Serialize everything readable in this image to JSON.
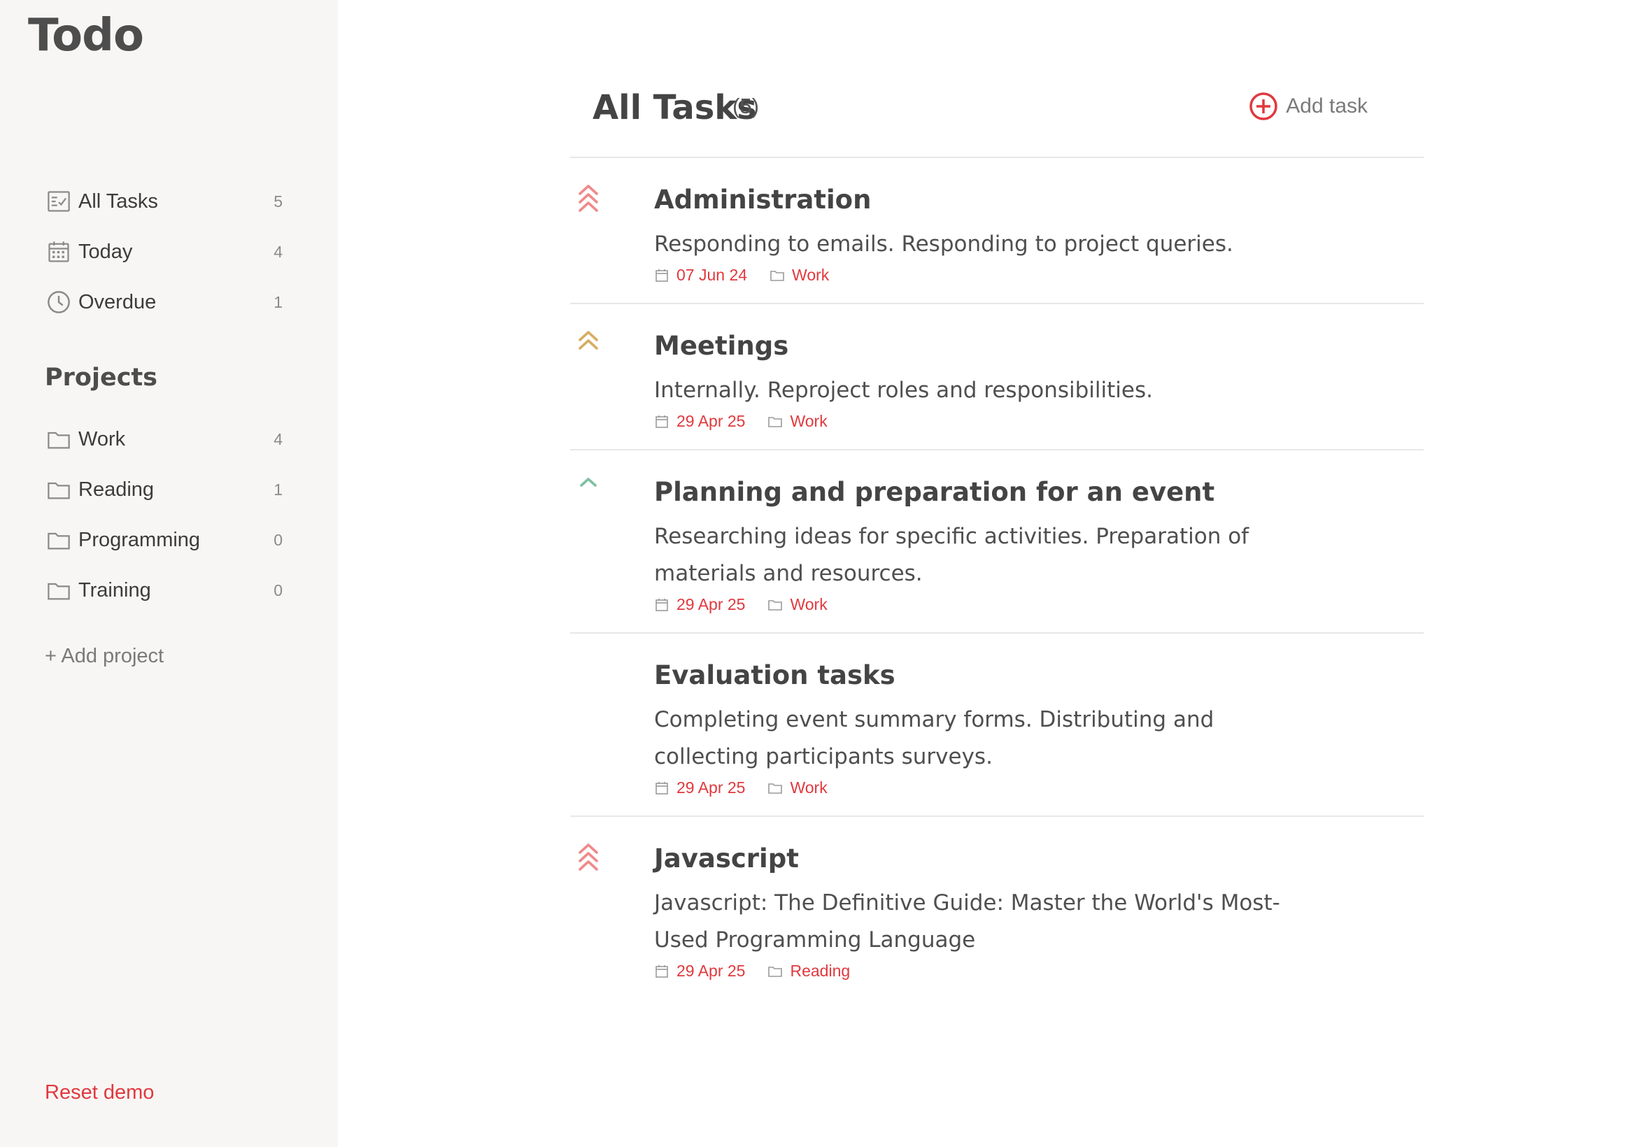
{
  "app": {
    "title": "Todo"
  },
  "sidebar": {
    "nav": [
      {
        "label": "All Tasks",
        "count": "5",
        "icon": "task-list-icon"
      },
      {
        "label": "Today",
        "count": "4",
        "icon": "calendar-icon"
      },
      {
        "label": "Overdue",
        "count": "1",
        "icon": "clock-icon"
      }
    ],
    "projects_heading": "Projects",
    "projects": [
      {
        "label": "Work",
        "count": "4",
        "icon": "folder-icon"
      },
      {
        "label": "Reading",
        "count": "1",
        "icon": "folder-icon"
      },
      {
        "label": "Programming",
        "count": "0",
        "icon": "folder-icon"
      },
      {
        "label": "Training",
        "count": "0",
        "icon": "folder-icon"
      }
    ],
    "add_project": "+ Add project",
    "reset_demo": "Reset demo"
  },
  "main": {
    "title": "All Tasks",
    "count": "(5)",
    "add_task": "Add task"
  },
  "colors": {
    "accent": "#e0393e",
    "priority_high": "#ef8a8a",
    "priority_medium": "#d6ae62",
    "priority_low": "#7fbfa3",
    "sidebar_bg": "#f8f6f4"
  },
  "tasks": [
    {
      "title": "Administration",
      "description": "Responding to emails. Responding to project queries.",
      "date": "07 Jun 24",
      "project": "Work",
      "priority": "high"
    },
    {
      "title": "Meetings",
      "description": "Internally. Reproject roles and responsibilities.",
      "date": "29 Apr 25",
      "project": "Work",
      "priority": "medium"
    },
    {
      "title": "Planning and preparation for an event",
      "description": "Researching ideas for specific activities. Preparation of materials and resources.",
      "date": "29 Apr 25",
      "project": "Work",
      "priority": "low"
    },
    {
      "title": "Evaluation tasks",
      "description": "Completing event summary forms. Distributing and collecting participants surveys.",
      "date": "29 Apr 25",
      "project": "Work",
      "priority": "none"
    },
    {
      "title": "Javascript",
      "description": "Javascript: The Definitive Guide: Master the World's Most-Used Programming Language",
      "date": "29 Apr 25",
      "project": "Reading",
      "priority": "high"
    }
  ]
}
